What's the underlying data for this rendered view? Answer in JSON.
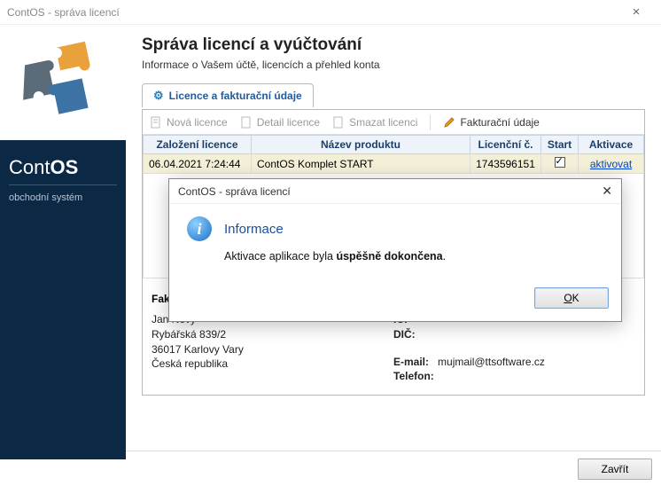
{
  "window": {
    "title": "ContOS - správa licencí"
  },
  "brand": {
    "name_left": "Cont",
    "name_right": "OS",
    "subtitle": "obchodní systém"
  },
  "page": {
    "title": "Správa licencí a vyúčtování",
    "subtitle": "Informace o Vašem účtě, licencích a přehled konta"
  },
  "tab": {
    "label": "Licence a fakturační údaje"
  },
  "toolbar": {
    "new_license": "Nová licence",
    "detail": "Detail licence",
    "delete": "Smazat licenci",
    "billing": "Fakturační údaje"
  },
  "table": {
    "headers": {
      "created": "Založení licence",
      "product": "Název produktu",
      "licno": "Licenční č.",
      "start": "Start",
      "activation": "Aktivace"
    },
    "rows": [
      {
        "created": "06.04.2021 7:24:44",
        "product": "ContOS Komplet START",
        "licno": "1743596151",
        "start_checked": true,
        "activation": "aktivovat"
      }
    ]
  },
  "billing": {
    "section_label": "Fakt",
    "name": "Jan Nový",
    "street": "Rybářská 839/2",
    "city": "36017  Karlovy Vary",
    "country": "Česká republika",
    "labels": {
      "ic": "IČ:",
      "dic": "DIČ:",
      "email": "E-mail:",
      "phone": "Telefon:"
    },
    "email": "mujmail@ttsoftware.cz"
  },
  "footer": {
    "close": "Zavřít"
  },
  "dialog": {
    "title": "ContOS - správa licencí",
    "heading": "Informace",
    "msg_prefix": "Aktivace aplikace byla ",
    "msg_bold": "úspěšně dokončena",
    "msg_suffix": ".",
    "ok": "OK"
  }
}
